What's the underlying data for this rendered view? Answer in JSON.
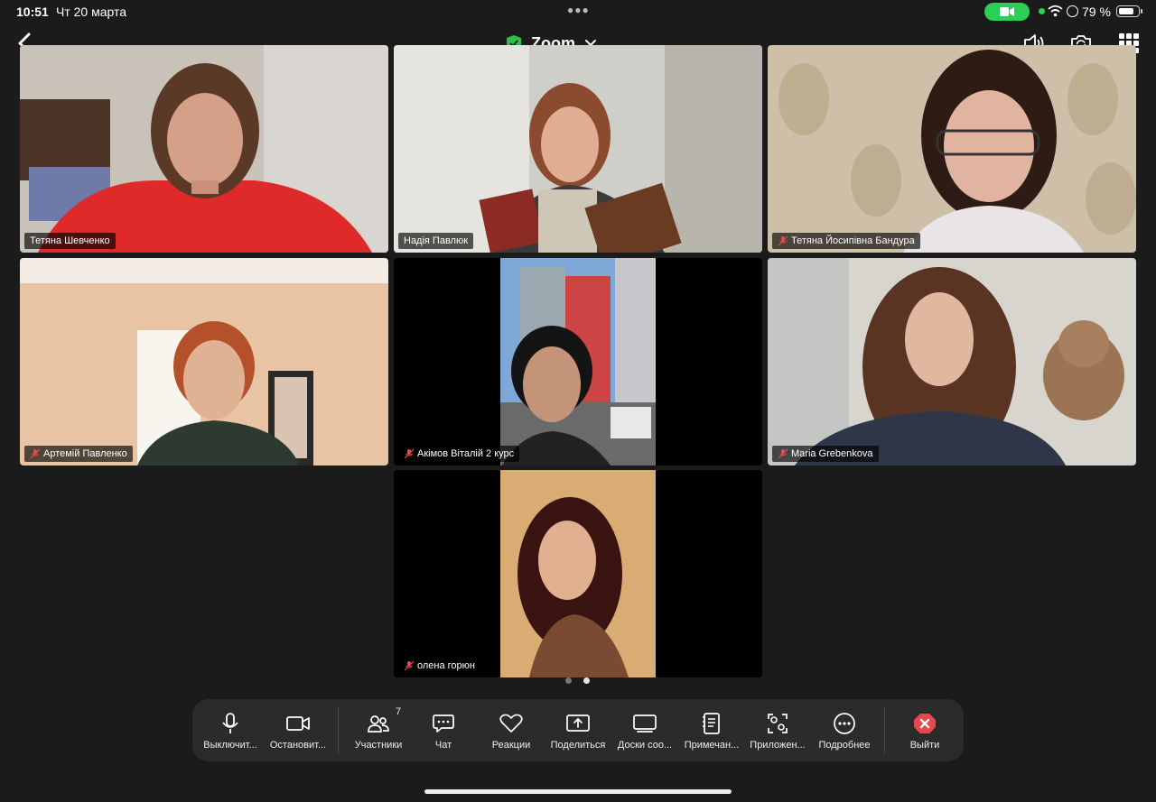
{
  "status_bar": {
    "time": "10:51",
    "date": "Чт 20 марта",
    "battery_percent": "79 %",
    "battery_level": 0.79,
    "camera_indicator_color": "#2bcf55"
  },
  "header": {
    "title": "Zoom",
    "shield_icon": "green-shield-check-icon",
    "icons": [
      "back-chevron-icon",
      "speaker-icon",
      "switch-camera-icon",
      "grid-view-icon"
    ]
  },
  "participants": [
    {
      "name": "Тетяна Шевченко",
      "muted": false,
      "active_speaker": false
    },
    {
      "name": "Надія Павлюк",
      "muted": false,
      "active_speaker": true
    },
    {
      "name": "Тетяна Йосипівна Бандура",
      "muted": true,
      "active_speaker": false
    },
    {
      "name": "Артемій Павленко",
      "muted": true,
      "active_speaker": false
    },
    {
      "name": "Акімов Віталій 2 курс",
      "muted": true,
      "active_speaker": false
    },
    {
      "name": "Maria Grebenkova",
      "muted": true,
      "active_speaker": false
    },
    {
      "name": "олена горюн",
      "muted": true,
      "active_speaker": false
    }
  ],
  "pager": {
    "pages": 2,
    "current": 2
  },
  "toolbar": {
    "mute": "Выключит...",
    "video": "Остановит...",
    "participants": "Участники",
    "participants_count": "7",
    "chat": "Чат",
    "reactions": "Реакции",
    "share": "Поделиться",
    "whiteboards": "Доски соо...",
    "notes": "Примечан...",
    "apps": "Приложен...",
    "more": "Подробнее",
    "leave": "Выйти"
  },
  "colors": {
    "active_border": "#2bbf4e",
    "muted_mic": "#e5484d",
    "leave": "#e5484d"
  }
}
